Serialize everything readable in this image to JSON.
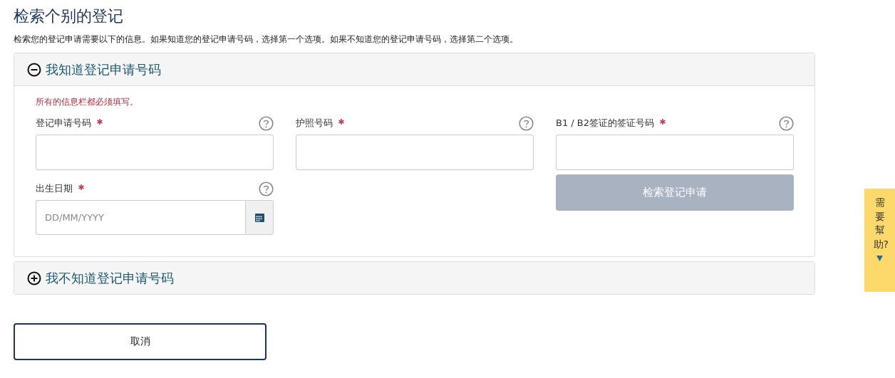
{
  "title": "检索个别的登记",
  "description": "检索您的登记申请需要以下的信息。如果知道您的登记申请号码，选择第一个选项。如果不知道您的登记申请号码，选择第二个选项。",
  "sections": [
    {
      "title": "我知道登记申请号码",
      "expanded": true,
      "required_note": "所有的信息栏都必须填写。",
      "fields": [
        {
          "kind": "text",
          "label": "登记申请号码",
          "required": true
        },
        {
          "kind": "text",
          "label": "护照号码",
          "required": true
        },
        {
          "kind": "text",
          "label": "B1 / B2签证的签证号码",
          "required": true
        },
        {
          "kind": "date",
          "label": "出生日期",
          "required": true,
          "placeholder": "DD/MM/YYYY"
        }
      ],
      "submit": {
        "label": "检索登记申请",
        "disabled": true
      }
    },
    {
      "title": "我不知道登记申请号码",
      "expanded": false
    }
  ],
  "cancel_button": "取消",
  "help_tab": "需要幫助?"
}
